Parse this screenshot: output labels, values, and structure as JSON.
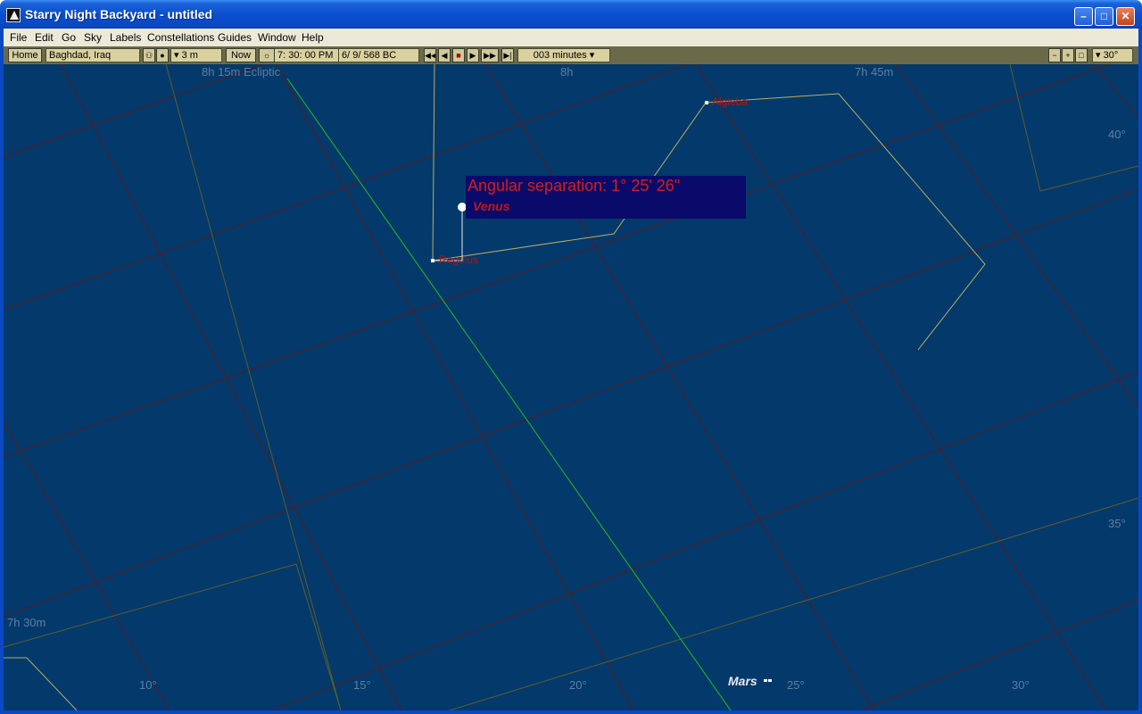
{
  "window": {
    "title": "Starry Night Backyard - untitled",
    "minimize": "–",
    "maximize": "□",
    "close": "✕",
    "icon": "app-icon"
  },
  "menu": [
    "File",
    "Edit",
    "Go",
    "Sky",
    "Labels",
    "Constellations",
    "Guides",
    "Window",
    "Help"
  ],
  "toolbar": {
    "home_label": "Home",
    "location": "Baghdad, Iraq",
    "elevation": "▾ 3 m",
    "now_label": "Now",
    "time": "7: 30: 00 PM",
    "date": "6/  9/  568 BC",
    "time_step": "003 minutes ▾",
    "zoom": "▾ 30°",
    "icons": {
      "binoculars": "binoculars-icon",
      "flashlight": "flashlight-icon",
      "sun": "sun-icon",
      "step_back_fast": "step-back-fast-icon",
      "step_back": "step-back-icon",
      "stop": "stop-icon",
      "play": "play-icon",
      "play_fast": "play-fast-icon",
      "step_forward": "step-forward-icon",
      "zoom_out": "zoom-out-icon",
      "zoom_in": "zoom-in-icon",
      "zoom_fit": "zoom-fit-icon"
    }
  },
  "sky": {
    "ra_labels": [
      "8h 15m Ecliptic",
      "8h",
      "7h 45m",
      "7h 30m"
    ],
    "dec_labels": [
      "40°",
      "35°",
      "10°",
      "15°",
      "20°",
      "25°",
      "30°"
    ],
    "stars": [
      "Algieba",
      "Regulus"
    ],
    "angular_separation": "Angular separation: 1° 25' 26\"",
    "planets": [
      "Venus",
      "Mars"
    ]
  },
  "colors": {
    "sky": "#04396b",
    "grid_ra": "#5a1a1a",
    "ecliptic": "#20c020",
    "constellation": "#b8b060",
    "boundary": "#5e5e2c"
  }
}
